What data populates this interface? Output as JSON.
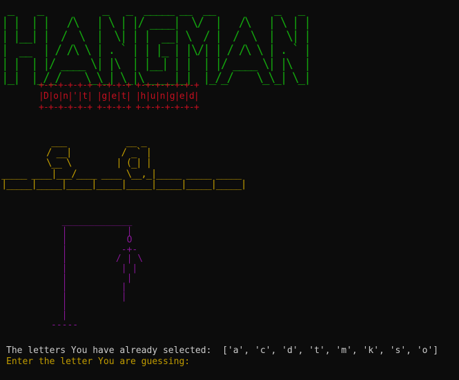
{
  "colors": {
    "background": "#0c0c0c",
    "banner": "#13a10e",
    "slogan": "#c50f1f",
    "word": "#c19c00",
    "gallows": "#881798",
    "text": "#cccccc",
    "prompt": "#c19c00"
  },
  "banner_ascii": " _    _          _   _  _____ __  __          _   _\n| |  | |   /\\   | \\ | |/ ____|  \\/  |   /\\   | \\ | |\n| |__| |  /  \\  |  \\| | |  __| \\  / |  /  \\  |  \\| |\n|  __  | / /\\ \\ | . ` | | |_ | |\\/| | / /\\ \\ | . ` |\n| |  | |/ ____ \\| |\\  | |__| | |  | |/ ____ \\| |\\  |\n|_|  |_/_/    \\_\\_| \\_|\\_____|_|  |_/_/    \\_\\_| \\_|",
  "slogan_ascii": "+-+-+-+-+-+ +-+-+-+ +-+-+-+-+-+-+\n|D|o|n|'|t| |g|e|t| |h|u|n|g|e|d|\n+-+-+-+-+-+ +-+-+-+ +-+-+-+-+-+-+",
  "word_ascii": "          ___            __ _\n         / __|          / _` |\n         \\__ \\         | (_| |\n_____ ____|___/____ ____ \\__,_|_____ _____ _____\n|_____|_____|_____|_____|_____|_____|_____|_____|",
  "gallows_ascii": "  _____________\n  |           |\n  |           O\n  |          -+-\n  |         / | \\\n  |          | |\n  |           |\n  |          |\n  |          |\n  |\n  |\n-----",
  "status": {
    "selected_label": "The letters You have already selected:  ['a', 'c', 'd', 't', 'm', 'k', 's', 'o']",
    "prompt_label": "Enter the letter You are guessing:"
  }
}
